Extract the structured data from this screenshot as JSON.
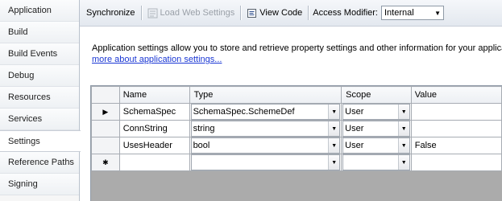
{
  "sidebar": {
    "items": [
      {
        "label": "Application"
      },
      {
        "label": "Build"
      },
      {
        "label": "Build Events"
      },
      {
        "label": "Debug"
      },
      {
        "label": "Resources"
      },
      {
        "label": "Services"
      },
      {
        "label": "Settings",
        "selected": true
      },
      {
        "label": "Reference Paths"
      },
      {
        "label": "Signing"
      }
    ]
  },
  "toolbar": {
    "synchronize_label": "Synchronize",
    "load_web_settings_label": "Load Web Settings",
    "view_code_label": "View Code",
    "access_modifier_label": "Access Modifier:",
    "access_modifier_value": "Internal"
  },
  "description": {
    "text": "Application settings allow you to store and retrieve property settings and other information for your applicatio",
    "link_text": "more about application settings..."
  },
  "grid": {
    "columns": [
      "Name",
      "Type",
      "Scope",
      "Value"
    ],
    "rows": [
      {
        "marker": "▶",
        "name": "SchemaSpec",
        "type": "SchemaSpec.SchemeDef",
        "scope": "User",
        "value": ""
      },
      {
        "marker": "",
        "name": "ConnString",
        "type": "string",
        "scope": "User",
        "value": ""
      },
      {
        "marker": "",
        "name": "UsesHeader",
        "type": "bool",
        "scope": "User",
        "value": "False"
      },
      {
        "marker": "✱",
        "name": "",
        "type": "",
        "scope": "",
        "value": ""
      }
    ]
  },
  "icons": {
    "synchronize": "synchronize-icon",
    "load_web_settings": "load-web-settings-icon",
    "view_code": "view-code-icon",
    "dropdown": "chevron-down-icon"
  },
  "colors": {
    "link": "#1a37d4",
    "disabled_text": "#9aa0a8",
    "toolbar_top": "#f5f7fa",
    "toolbar_bottom": "#e3e8ef"
  }
}
